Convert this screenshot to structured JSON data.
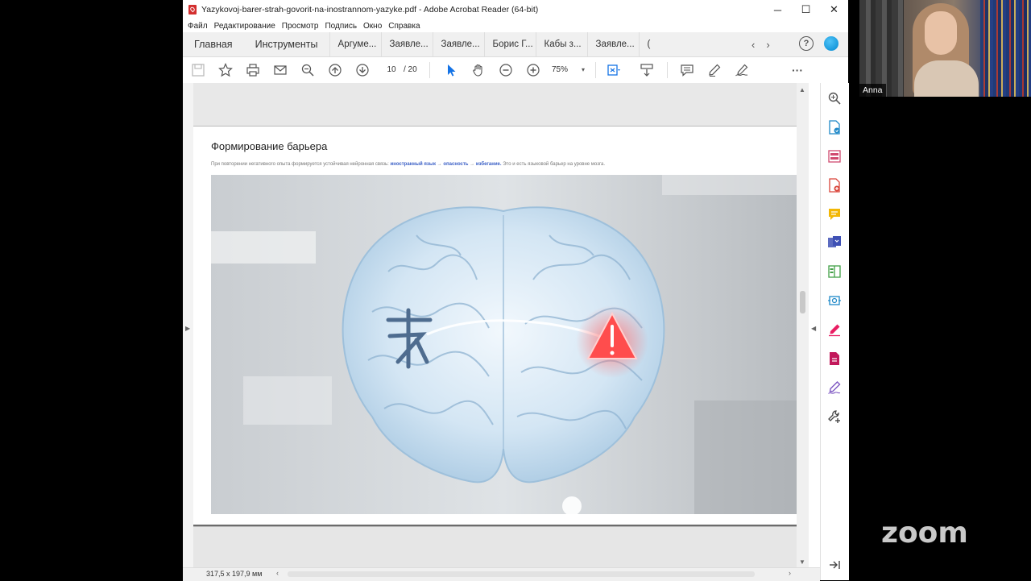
{
  "window": {
    "title": "Yazykovoj-barer-strah-govorit-na-inostrannom-yazyke.pdf - Adobe Acrobat Reader (64-bit)",
    "controls": {
      "minimize": "─",
      "maximize": "☐",
      "close": "✕"
    }
  },
  "menu": [
    "Файл",
    "Редактирование",
    "Просмотр",
    "Подпись",
    "Окно",
    "Справка"
  ],
  "tabs": {
    "home": "Главная",
    "tools": "Инструменты",
    "docs": [
      "Аргуме...",
      "Заявле...",
      "Заявле...",
      "Борис Г...",
      "Кабы з...",
      "Заявле...",
      "("
    ],
    "prev_arrow": "‹",
    "next_arrow": "›",
    "help": "?"
  },
  "toolbar": {
    "page_current": "10",
    "page_total": "/ 20",
    "zoom": "75%",
    "zoom_dropdown": "▾",
    "more": "···"
  },
  "slide": {
    "title": "Формирование барьера",
    "subtitle_pre": "При повторении негативного опыта формируется устойчивая нейронная связь:",
    "subtitle_hl1": "иностранный язык",
    "subtitle_arrow1": " → ",
    "subtitle_hl2": "опасность",
    "subtitle_arrow2": " → ",
    "subtitle_hl3": "избегание.",
    "subtitle_post": " Это и есть языковой барьер на уровне мозга."
  },
  "statusbar": {
    "dimensions": "317,5 x 197,9 мм",
    "scroll_left": "‹",
    "scroll_right": "›"
  },
  "scroll": {
    "up": "▲",
    "down": "▼",
    "left_pane": "▶",
    "right_pane": "◀"
  },
  "video": {
    "participant_name": "Anna"
  },
  "branding": {
    "zoom_logo": "zoom"
  },
  "colors": {
    "accent_blue": "#1473e6",
    "brand_red": "#d32f2f",
    "highlight": "#3a5fc6"
  }
}
